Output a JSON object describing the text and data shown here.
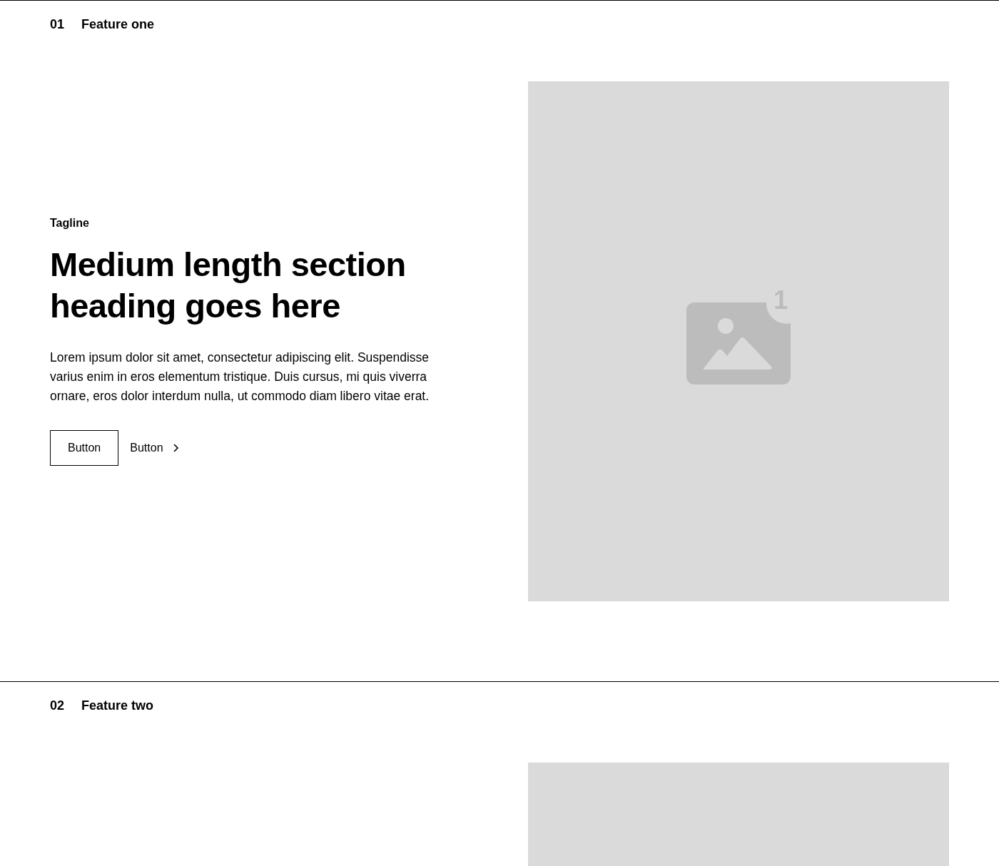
{
  "sections": [
    {
      "number": "01",
      "title": "Feature one",
      "tagline": "Tagline",
      "heading": "Medium length section heading goes here",
      "body": "Lorem ipsum dolor sit amet, consectetur adipiscing elit. Suspendisse varius enim in eros elementum tristique. Duis cursus, mi quis viverra ornare, eros dolor interdum nulla, ut commodo diam libero vitae erat.",
      "buttons": [
        {
          "kind": "outline",
          "label": "Button"
        },
        {
          "kind": "link",
          "label": "Button"
        }
      ],
      "image": {
        "kind": "placeholder",
        "badge": "1"
      }
    },
    {
      "number": "02",
      "title": "Feature two",
      "image": {
        "kind": "placeholder"
      }
    }
  ]
}
